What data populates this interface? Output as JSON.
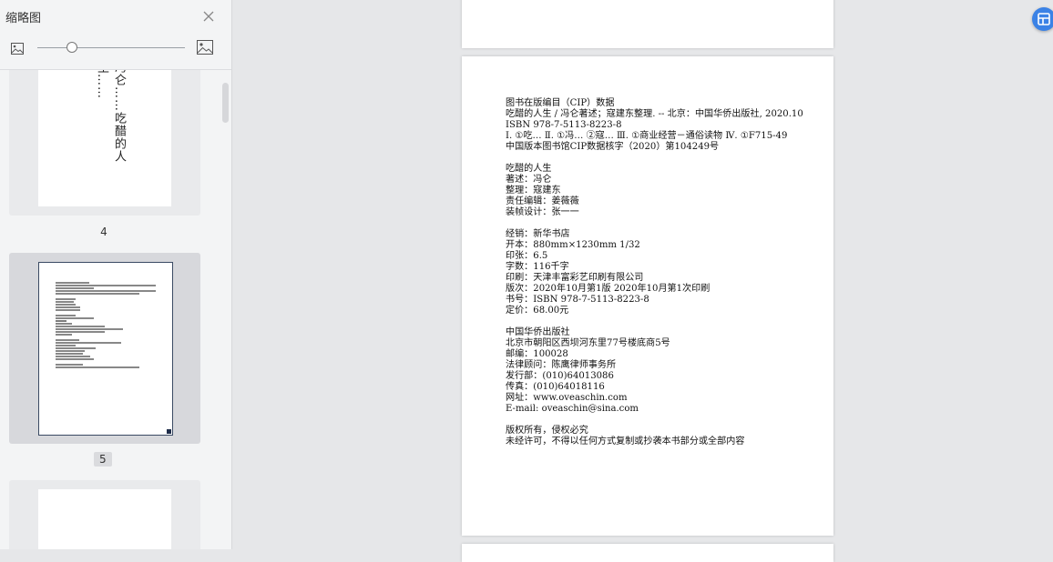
{
  "sidebar": {
    "title": "缩略图",
    "thumbnails": [
      {
        "page_label": "4",
        "vertical_text": "冯仑……吃醋的人生……"
      },
      {
        "page_label": "5"
      },
      {
        "page_label": ""
      }
    ]
  },
  "document": {
    "cip_lines": [
      "图书在版编目（CIP）数据",
      "吃醋的人生 / 冯仑著述；寇建东整理. -- 北京：中国华侨出版社, 2020.10",
      "ISBN 978-7-5113-8223-8",
      "Ⅰ. ①吃… Ⅱ. ①冯… ②寇… Ⅲ. ①商业经营－通俗读物 Ⅳ. ①F715-49",
      "中国版本图书馆CIP数据核字（2020）第104249号"
    ],
    "credit_lines": [
      "吃醋的人生",
      "著述：冯仑",
      "整理：寇建东",
      "责任编辑：姜薇薇",
      "装帧设计：张一一"
    ],
    "spec_lines": [
      "经销：新华书店",
      "开本：880mm×1230mm 1/32",
      "印张：6.5",
      "字数：116千字",
      "印刷：天津丰富彩艺印刷有限公司",
      "版次：2020年10月第1版 2020年10月第1次印刷",
      "书号：ISBN 978-7-5113-8223-8",
      "定价：68.00元"
    ],
    "publisher_lines": [
      "中国华侨出版社",
      "北京市朝阳区西坝河东里77号楼底商5号",
      "邮编：100028",
      "法律顾问：陈鹰律师事务所",
      "发行部：(010)64013086",
      "传真：(010)64018116",
      "网址：www.oveaschin.com",
      "E-mail: oveaschin@sina.com"
    ],
    "rights_lines": [
      "版权所有，侵权必究",
      "未经许可，不得以任何方式复制或抄袭本书部分或全部内容"
    ]
  },
  "colors": {
    "accent": "#3b82e6",
    "sidebar_bg": "#f3f4f5",
    "canvas_bg": "#e6e7e9"
  }
}
